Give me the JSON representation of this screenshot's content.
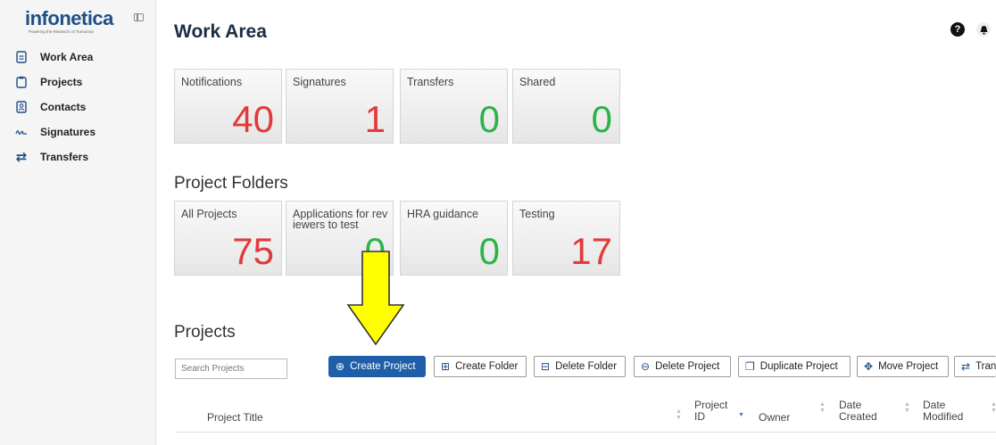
{
  "sidebar": {
    "logo_text": "infonetica",
    "logo_tagline": "Powering the Research of Tomorrow",
    "items": [
      {
        "label": "Work Area",
        "icon": "document-icon"
      },
      {
        "label": "Projects",
        "icon": "clipboard-icon"
      },
      {
        "label": "Contacts",
        "icon": "contact-card-icon"
      },
      {
        "label": "Signatures",
        "icon": "signature-icon"
      },
      {
        "label": "Transfers",
        "icon": "transfer-arrows-icon"
      }
    ]
  },
  "header": {
    "title": "Work Area",
    "help_glyph": "?",
    "bell_glyph": "●"
  },
  "summary_tiles": [
    {
      "label": "Notifications",
      "value": "40",
      "color": "#e03a3a"
    },
    {
      "label": "Signatures",
      "value": "1",
      "color": "#e03a3a"
    },
    {
      "label": "Transfers",
      "value": "0",
      "color": "#2bb34a"
    },
    {
      "label": "Shared",
      "value": "0",
      "color": "#2bb34a"
    }
  ],
  "folders": {
    "title": "Project Folders",
    "tiles": [
      {
        "label": "All Projects",
        "value": "75",
        "color": "#e03a3a"
      },
      {
        "label": "Applications for reviewers to test",
        "value": "0",
        "color": "#2bb34a"
      },
      {
        "label": "HRA guidance",
        "value": "0",
        "color": "#2bb34a"
      },
      {
        "label": "Testing",
        "value": "17",
        "color": "#e03a3a"
      }
    ]
  },
  "projects": {
    "title": "Projects",
    "search_placeholder": "Search Projects",
    "buttons": [
      {
        "label": "Create Project",
        "icon": "⊕"
      },
      {
        "label": "Create Folder",
        "icon": "⊞"
      },
      {
        "label": "Delete Folder",
        "icon": "⊟"
      },
      {
        "label": "Delete Project",
        "icon": "⊖"
      },
      {
        "label": "Duplicate Project",
        "icon": "❐"
      },
      {
        "label": "Move Project",
        "icon": "✥"
      },
      {
        "label": "Tran",
        "icon": "⇄"
      }
    ],
    "columns": [
      {
        "label": "Project Title"
      },
      {
        "label": "Project ID"
      },
      {
        "label": "Owner"
      },
      {
        "label": "Date Created"
      },
      {
        "label": "Date Modified"
      }
    ]
  },
  "colors": {
    "brand": "#1f4f86",
    "primary_button": "#1f5fa8",
    "alert_value": "#e03a3a",
    "ok_value": "#2bb34a",
    "annotation_arrow": "#ffff00"
  }
}
